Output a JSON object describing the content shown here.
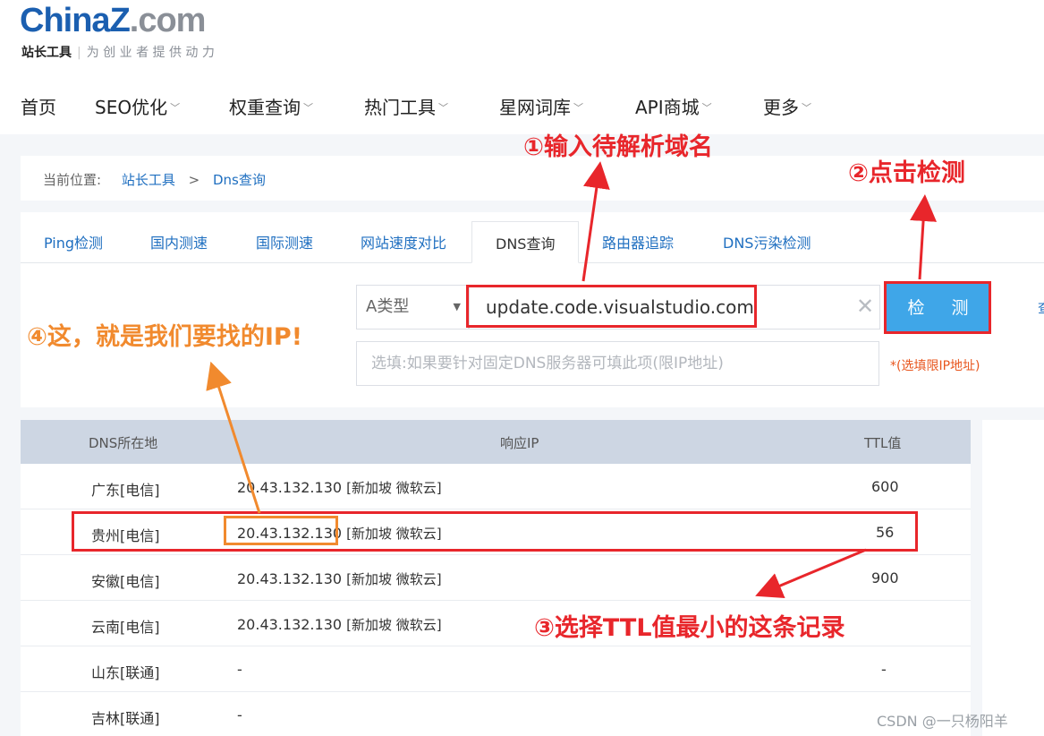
{
  "site": {
    "logo_main": "China",
    "logo_mark": "Z",
    "logo_suffix": ".com",
    "tag_strong": "站长工具",
    "tag_sep": "|",
    "tag_slogan": "为 创 业 者 提 供 动 力"
  },
  "nav": [
    {
      "label": "首页"
    },
    {
      "label": "SEO优化"
    },
    {
      "label": "权重查询"
    },
    {
      "label": "热门工具"
    },
    {
      "label": "星网词库"
    },
    {
      "label": "API商城"
    },
    {
      "label": "更多"
    }
  ],
  "breadcrumb": {
    "prefix": "当前位置:",
    "home": "站长工具",
    "separator": ">",
    "current": "Dns查询"
  },
  "tabs": [
    {
      "label": "Ping检测"
    },
    {
      "label": "国内测速"
    },
    {
      "label": "国际测速"
    },
    {
      "label": "网站速度对比"
    },
    {
      "label": "DNS查询"
    },
    {
      "label": "路由器追踪"
    },
    {
      "label": "DNS污染检测"
    }
  ],
  "form": {
    "record_type": "A类型",
    "domain_value": "update.code.visualstudio.com",
    "check_label": "检 测",
    "server_placeholder": "选填:如果要针对固定DNS服务器可填此项(限IP地址)",
    "server_hint": "*(选填限IP地址)",
    "right_cut_text": "查"
  },
  "table": {
    "headers": [
      "DNS所在地",
      "响应IP",
      "TTL值"
    ],
    "rows": [
      {
        "location": "广东[电信]",
        "ip": "20.43.132.130",
        "geo": "[新加坡 微软云]",
        "ttl": "600"
      },
      {
        "location": "贵州[电信]",
        "ip": "20.43.132.130",
        "geo": "[新加坡 微软云]",
        "ttl": "56"
      },
      {
        "location": "安徽[电信]",
        "ip": "20.43.132.130",
        "geo": "[新加坡 微软云]",
        "ttl": "900"
      },
      {
        "location": "云南[电信]",
        "ip": "20.43.132.130",
        "geo": "[新加坡 微软云]",
        "ttl": ""
      },
      {
        "location": "山东[联通]",
        "ip": "-",
        "geo": "",
        "ttl": "-"
      },
      {
        "location": "吉林[联通]",
        "ip": "-",
        "geo": "",
        "ttl": ""
      }
    ]
  },
  "annotations": {
    "step1": "①输入待解析域名",
    "step2": "②点击检测",
    "step3": "③选择TTL值最小的这条记录",
    "step4": "④这，就是我们要找的IP!",
    "red_color": "#e8262b",
    "orange_color": "#f18a2e"
  },
  "watermark": "CSDN @一只杨阳羊",
  "icons": {
    "chevron": "chevron-down-icon",
    "caret": "caret-down-icon",
    "clear": "close-icon"
  }
}
